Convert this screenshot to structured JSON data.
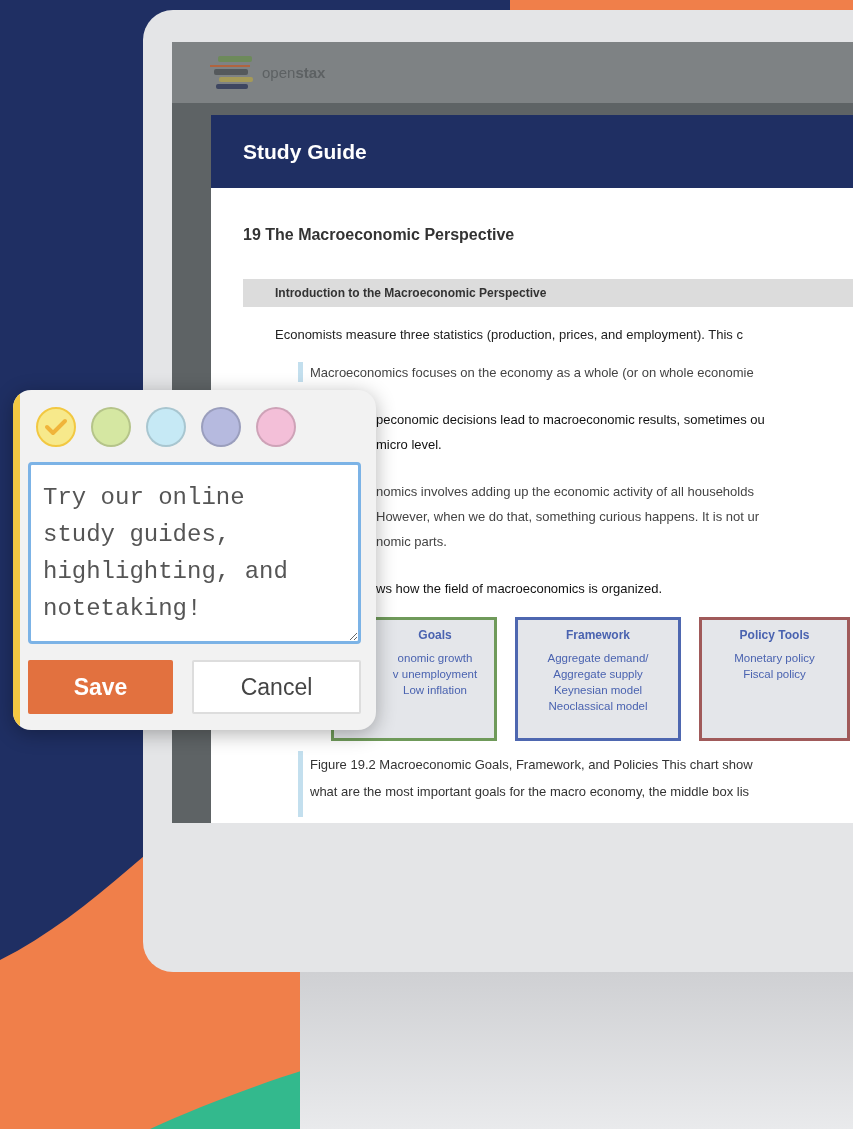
{
  "app_bar": {
    "logo_text": "open**stax**"
  },
  "panel": {
    "title": "Study Guide"
  },
  "chapter": {
    "title": "19 The Macroeconomic Perspective"
  },
  "section": {
    "title": "Introduction to the Macroeconomic Perspective"
  },
  "paragraphs": [
    {
      "kind": "text",
      "lines": [
        "Economists measure three statistics (production, prices, and employment). This c"
      ]
    },
    {
      "kind": "quote",
      "lines": [
        "Macroeconomics focuses on the economy as a whole (or on whole economie"
      ]
    },
    {
      "kind": "covered-bold",
      "lines": [
        "peconomic decisions lead to macroeconomic results, sometimes ou",
        "micro level."
      ]
    },
    {
      "kind": "covered",
      "lines": [
        "nomics involves adding up the economic activity of all households",
        "However, when we do that, something curious happens. It is not ur",
        "nomic parts."
      ]
    },
    {
      "kind": "covered-bold",
      "lines": [
        "ws how the field of macroeconomics is organized."
      ]
    }
  ],
  "figure": {
    "boxes": [
      {
        "title": "Goals",
        "lines": [
          "onomic growth",
          "v unemployment",
          "Low inflation"
        ],
        "color": "#6f9a5a",
        "covered": true
      },
      {
        "title": "Framework",
        "lines": [
          "Aggregate demand/",
          "Aggregate supply",
          "Keynesian model",
          "Neoclassical model"
        ],
        "color": "#4e67b0",
        "covered": false
      },
      {
        "title": "Policy Tools",
        "lines": [
          "Monetary policy",
          "Fiscal policy"
        ],
        "color": "#a05a5a",
        "covered": false
      }
    ],
    "caption_lines": [
      "Figure 19.2 Macroeconomic Goals, Framework, and Policies This chart show",
      "what are the most important goals for the macro economy, the middle box lis"
    ]
  },
  "note_editor": {
    "colors": [
      {
        "color": "#f7e98b",
        "selected": true
      },
      {
        "color": "#d5e7a2",
        "selected": false
      },
      {
        "color": "#c6e9f5",
        "selected": false
      },
      {
        "color": "#b6badf",
        "selected": false
      },
      {
        "color": "#f3bfd8",
        "selected": false
      }
    ],
    "text": "Try our online study guides, highlighting, and notetaking!",
    "buttons": [
      {
        "label": "Save",
        "kind": "primary"
      },
      {
        "label": "Cancel",
        "kind": "secondary"
      }
    ]
  }
}
